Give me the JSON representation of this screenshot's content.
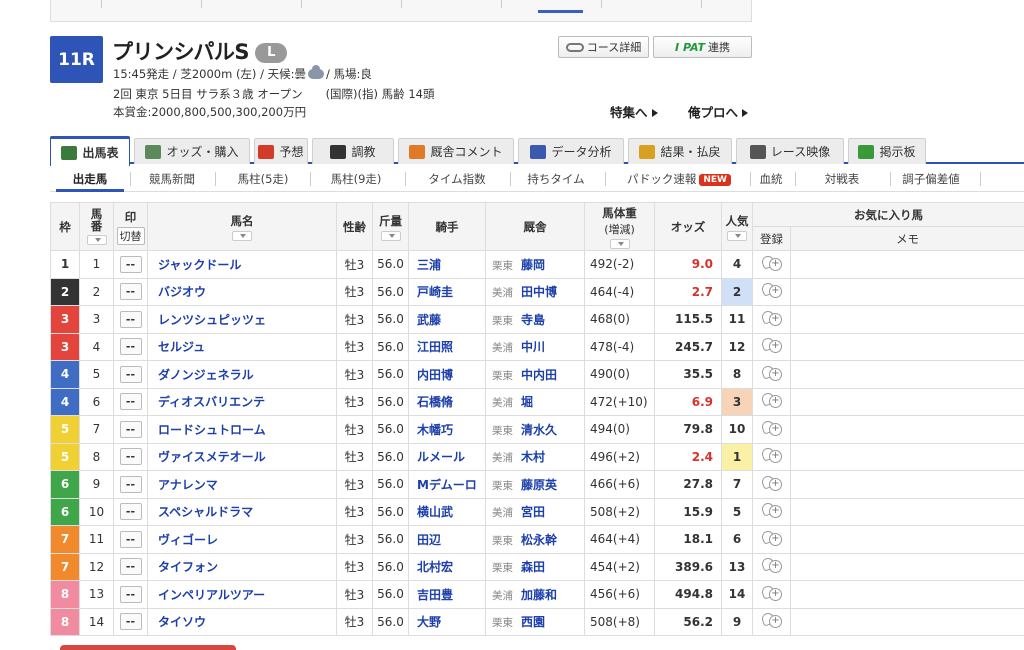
{
  "race": {
    "number": "11R",
    "name": "プリンシパルS",
    "grade": "L",
    "info_time_course": "15:45発走 / 芝2000m (左) / 天候:曇",
    "info_baba": "/ 馬場:良",
    "info_line2": "2回 東京 5日目 サラ系３歳 オープン　　(国際)(指) 馬齢 14頭",
    "info_line3": "本賞金:2000,800,500,300,200万円"
  },
  "header_buttons": {
    "course": "コース詳細",
    "ipat_logo": "I PAT",
    "ipat_label": "連携",
    "tokushu": "特集へ",
    "ore_pro": "俺プロへ"
  },
  "tabs": [
    {
      "label": "出馬表",
      "icon": "table-icon",
      "color": "#3a7a3a"
    },
    {
      "label": "オッズ・購入",
      "icon": "odds-icon",
      "color": "#5a8a5a"
    },
    {
      "label": "予想",
      "icon": "target-icon",
      "color": "#d23a2a"
    },
    {
      "label": "調教",
      "icon": "stopwatch-icon",
      "color": "#333333"
    },
    {
      "label": "厩舎コメント",
      "icon": "stable-icon",
      "color": "#e07a2a"
    },
    {
      "label": "データ分析",
      "icon": "chart-icon",
      "color": "#3a5ab0"
    },
    {
      "label": "結果・払戻",
      "icon": "coins-icon",
      "color": "#d8a020"
    },
    {
      "label": "レース映像",
      "icon": "video-icon",
      "color": "#555555"
    },
    {
      "label": "掲示板",
      "icon": "chat-icon",
      "color": "#3a9a3a"
    }
  ],
  "subnav": [
    "出走馬",
    "競馬新聞",
    "馬柱(5走)",
    "馬柱(9走)",
    "タイム指数",
    "持ちタイム",
    "パドック速報",
    "血統",
    "対戦表",
    "調子偏差値"
  ],
  "new_badge": "NEW",
  "table_headers": {
    "waku": "枠",
    "umaban": "馬番",
    "mark": "印",
    "kirikae": "切替",
    "name": "馬名",
    "sexage": "性齢",
    "weight": "斤量",
    "jockey": "騎手",
    "stable": "厩舎",
    "bw": "馬体重",
    "bw_sub": "(増減)",
    "odds": "オッズ",
    "pop": "人気",
    "fav": "お気に入り馬",
    "register": "登録",
    "memo": "メモ"
  },
  "waku_colors": {
    "1": [
      "#ffffff",
      "#333333"
    ],
    "2": [
      "#333333",
      "#ffffff"
    ],
    "3": [
      "#e3443b",
      "#ffffff"
    ],
    "4": [
      "#3f6dc4",
      "#ffffff"
    ],
    "5": [
      "#f1d034",
      "#ffffff"
    ],
    "6": [
      "#3fa64a",
      "#ffffff"
    ],
    "7": [
      "#f18a2c",
      "#ffffff"
    ],
    "8": [
      "#f08ba0",
      "#ffffff"
    ]
  },
  "horses": [
    {
      "waku": "1",
      "umaban": "1",
      "mark": "--",
      "name": "ジャックドール",
      "sexage": "牡3",
      "weight": "56.0",
      "jockey": "三浦",
      "region": "栗東",
      "trainer": "藤岡",
      "bw": "492(-2)",
      "odds": "9.0",
      "odds_red": true,
      "pop": "4",
      "pop_bg": ""
    },
    {
      "waku": "2",
      "umaban": "2",
      "mark": "--",
      "name": "バジオウ",
      "sexage": "牡3",
      "weight": "56.0",
      "jockey": "戸崎圭",
      "region": "美浦",
      "trainer": "田中博",
      "bw": "464(-4)",
      "odds": "2.7",
      "odds_red": true,
      "pop": "2",
      "pop_bg": "#cfe0f7"
    },
    {
      "waku": "3",
      "umaban": "3",
      "mark": "--",
      "name": "レンツシュピッツェ",
      "sexage": "牡3",
      "weight": "56.0",
      "jockey": "武藤",
      "region": "栗東",
      "trainer": "寺島",
      "bw": "468(0)",
      "odds": "115.5",
      "odds_red": false,
      "pop": "11",
      "pop_bg": ""
    },
    {
      "waku": "3",
      "umaban": "4",
      "mark": "--",
      "name": "セルジュ",
      "sexage": "牡3",
      "weight": "56.0",
      "jockey": "江田照",
      "region": "美浦",
      "trainer": "中川",
      "bw": "478(-4)",
      "odds": "245.7",
      "odds_red": false,
      "pop": "12",
      "pop_bg": ""
    },
    {
      "waku": "4",
      "umaban": "5",
      "mark": "--",
      "name": "ダノンジェネラル",
      "sexage": "牡3",
      "weight": "56.0",
      "jockey": "内田博",
      "region": "栗東",
      "trainer": "中内田",
      "bw": "490(0)",
      "odds": "35.5",
      "odds_red": false,
      "pop": "8",
      "pop_bg": ""
    },
    {
      "waku": "4",
      "umaban": "6",
      "mark": "--",
      "name": "ディオスバリエンテ",
      "sexage": "牡3",
      "weight": "56.0",
      "jockey": "石橋脩",
      "region": "美浦",
      "trainer": "堀",
      "bw": "472(+10)",
      "odds": "6.9",
      "odds_red": true,
      "pop": "3",
      "pop_bg": "#f7d3b8"
    },
    {
      "waku": "5",
      "umaban": "7",
      "mark": "--",
      "name": "ロードシュトローム",
      "sexage": "牡3",
      "weight": "56.0",
      "jockey": "木幡巧",
      "region": "栗東",
      "trainer": "清水久",
      "bw": "494(0)",
      "odds": "79.8",
      "odds_red": false,
      "pop": "10",
      "pop_bg": ""
    },
    {
      "waku": "5",
      "umaban": "8",
      "mark": "--",
      "name": "ヴァイスメテオール",
      "sexage": "牡3",
      "weight": "56.0",
      "jockey": "ルメール",
      "region": "美浦",
      "trainer": "木村",
      "bw": "496(+2)",
      "odds": "2.4",
      "odds_red": true,
      "pop": "1",
      "pop_bg": "#fbf1a6"
    },
    {
      "waku": "6",
      "umaban": "9",
      "mark": "--",
      "name": "アナレンマ",
      "sexage": "牡3",
      "weight": "56.0",
      "jockey": "Mデムーロ",
      "region": "栗東",
      "trainer": "藤原英",
      "bw": "466(+6)",
      "odds": "27.8",
      "odds_red": false,
      "pop": "7",
      "pop_bg": ""
    },
    {
      "waku": "6",
      "umaban": "10",
      "mark": "--",
      "name": "スペシャルドラマ",
      "sexage": "牡3",
      "weight": "56.0",
      "jockey": "横山武",
      "region": "美浦",
      "trainer": "宮田",
      "bw": "508(+2)",
      "odds": "15.9",
      "odds_red": false,
      "pop": "5",
      "pop_bg": ""
    },
    {
      "waku": "7",
      "umaban": "11",
      "mark": "--",
      "name": "ヴィゴーレ",
      "sexage": "牡3",
      "weight": "56.0",
      "jockey": "田辺",
      "region": "栗東",
      "trainer": "松永幹",
      "bw": "464(+4)",
      "odds": "18.1",
      "odds_red": false,
      "pop": "6",
      "pop_bg": ""
    },
    {
      "waku": "7",
      "umaban": "12",
      "mark": "--",
      "name": "タイフォン",
      "sexage": "牡3",
      "weight": "56.0",
      "jockey": "北村宏",
      "region": "栗東",
      "trainer": "森田",
      "bw": "454(+2)",
      "odds": "389.6",
      "odds_red": false,
      "pop": "13",
      "pop_bg": ""
    },
    {
      "waku": "8",
      "umaban": "13",
      "mark": "--",
      "name": "インペリアルツアー",
      "sexage": "牡3",
      "weight": "56.0",
      "jockey": "吉田豊",
      "region": "美浦",
      "trainer": "加藤和",
      "bw": "456(+6)",
      "odds": "494.8",
      "odds_red": false,
      "pop": "14",
      "pop_bg": ""
    },
    {
      "waku": "8",
      "umaban": "14",
      "mark": "--",
      "name": "タイソウ",
      "sexage": "牡3",
      "weight": "56.0",
      "jockey": "大野",
      "region": "栗東",
      "trainer": "西園",
      "bw": "508(+8)",
      "odds": "56.2",
      "odds_red": false,
      "pop": "9",
      "pop_bg": ""
    }
  ]
}
